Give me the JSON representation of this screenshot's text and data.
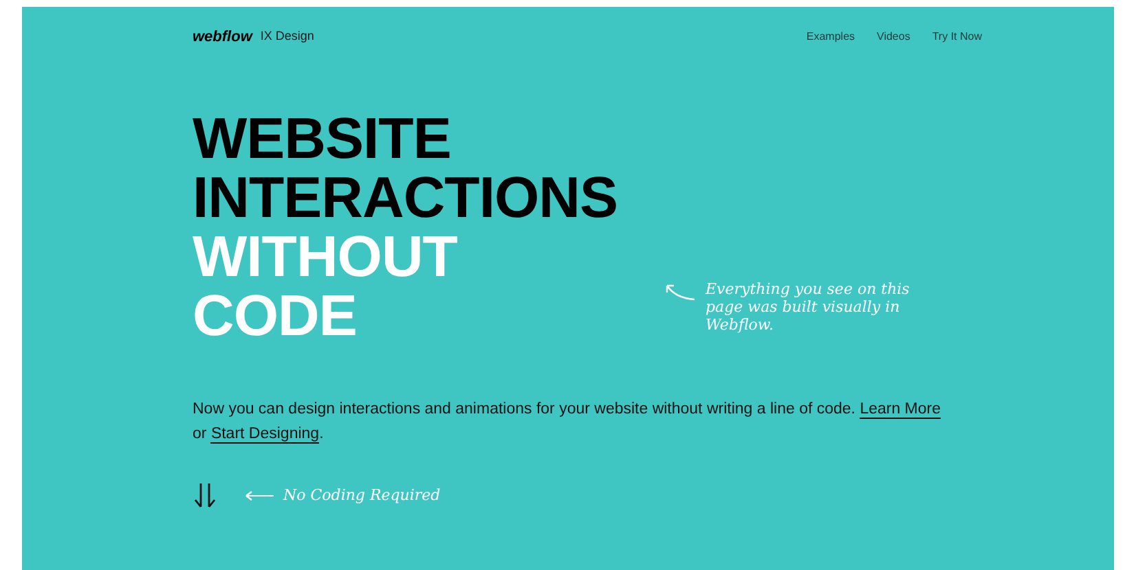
{
  "header": {
    "logo": "webflow",
    "product": "IX Design",
    "nav": [
      "Examples",
      "Videos",
      "Try It Now"
    ]
  },
  "headline": [
    {
      "text": "WEBSITE",
      "color": "#000000"
    },
    {
      "text": "INTERACTIONS",
      "color": "#000000"
    },
    {
      "text": "WITHOUT",
      "color": "#ffffff"
    },
    {
      "text": "CODE",
      "color": "#ffffff"
    }
  ],
  "note": "Everything you see on this page was built visually in Webflow.",
  "intro": {
    "text": "Now you can design interactions and animations for your website without writing a line of code.",
    "link_1": "Learn More",
    "middle": "or",
    "link_2": "Start Designing",
    "end": "."
  },
  "scroll_hint": "No Coding Required"
}
